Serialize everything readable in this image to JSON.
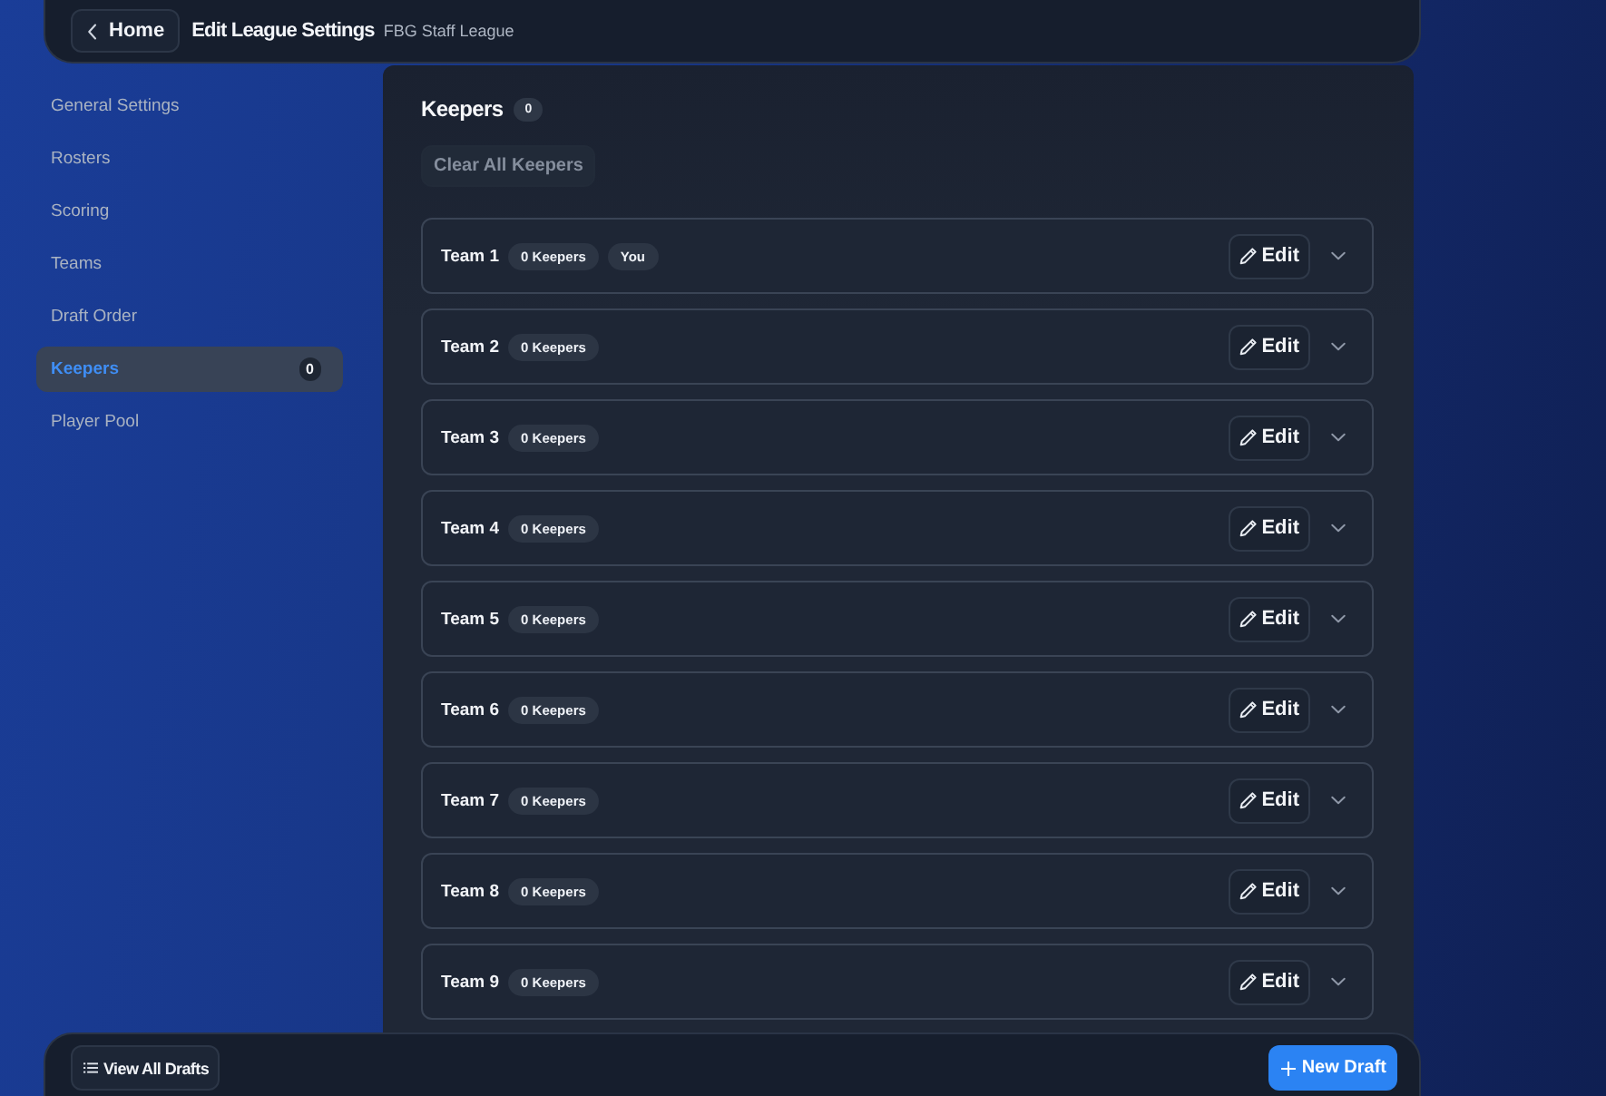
{
  "header": {
    "back_button": "Home",
    "title": "Edit League Settings",
    "subtitle": "FBG Staff League"
  },
  "sidebar": {
    "items": [
      {
        "label": "General Settings",
        "selected": false
      },
      {
        "label": "Rosters",
        "selected": false
      },
      {
        "label": "Scoring",
        "selected": false
      },
      {
        "label": "Teams",
        "selected": false
      },
      {
        "label": "Draft Order",
        "selected": false
      },
      {
        "label": "Keepers",
        "selected": true,
        "count": "0"
      },
      {
        "label": "Player Pool",
        "selected": false
      }
    ]
  },
  "keepers": {
    "title": "Keepers",
    "count": "0",
    "clear_button": {
      "label": "Clear All Keepers",
      "disabled": true
    },
    "teams": [
      {
        "name": "Team 1",
        "keepers": "0 Keepers",
        "tag": "You",
        "edit_label": "Edit",
        "expanded": false
      },
      {
        "name": "Team 2",
        "keepers": "0 Keepers",
        "edit_label": "Edit",
        "expanded": false
      },
      {
        "name": "Team 3",
        "keepers": "0 Keepers",
        "edit_label": "Edit",
        "expanded": false
      },
      {
        "name": "Team 4",
        "keepers": "0 Keepers",
        "edit_label": "Edit",
        "expanded": false
      },
      {
        "name": "Team 5",
        "keepers": "0 Keepers",
        "edit_label": "Edit",
        "expanded": false
      },
      {
        "name": "Team 6",
        "keepers": "0 Keepers",
        "edit_label": "Edit",
        "expanded": false
      },
      {
        "name": "Team 7",
        "keepers": "0 Keepers",
        "edit_label": "Edit",
        "expanded": false
      },
      {
        "name": "Team 8",
        "keepers": "0 Keepers",
        "edit_label": "Edit",
        "expanded": false
      },
      {
        "name": "Team 9",
        "keepers": "0 Keepers",
        "edit_label": "Edit",
        "expanded": false
      }
    ]
  },
  "footer": {
    "view_all_button": "View All Drafts",
    "new_button": "New Draft"
  }
}
